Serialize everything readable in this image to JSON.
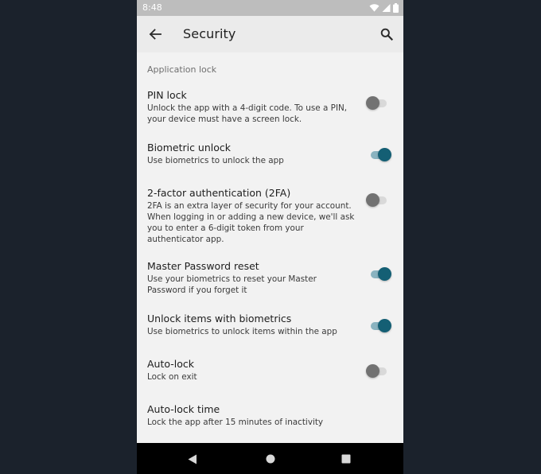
{
  "status_bar": {
    "time": "8:48",
    "icons": [
      "wifi-icon",
      "signal-icon",
      "battery-icon"
    ]
  },
  "app_bar": {
    "title": "Security",
    "back_icon": "arrow-back-icon",
    "search_icon": "search-icon"
  },
  "section": {
    "header": "Application lock"
  },
  "settings": [
    {
      "title": "PIN lock",
      "description": "Unlock the app with a 4-digit code. To use a PIN, your device must have a screen lock.",
      "enabled": false
    },
    {
      "title": "Biometric unlock",
      "description": "Use biometrics to unlock the app",
      "enabled": true
    },
    {
      "title": "2-factor authentication (2FA)",
      "description": "2FA is an extra layer of security for your account. When logging in or adding a new device, we'll ask you to enter a 6-digit token from your authenticator app.",
      "enabled": false
    },
    {
      "title": "Master Password reset",
      "description": "Use your biometrics to reset your Master Password if you forget it",
      "enabled": true
    },
    {
      "title": "Unlock items with biometrics",
      "description": "Use biometrics to unlock items within the app",
      "enabled": true
    },
    {
      "title": "Auto-lock",
      "description": "Lock on exit",
      "enabled": false
    },
    {
      "title": "Auto-lock time",
      "description": "Lock the app after 15 minutes of inactivity"
    }
  ],
  "colors": {
    "accent": "#145f74",
    "accent_track": "#8ab3c0",
    "switch_off_thumb": "#727272",
    "switch_off_track": "#d9d9d9",
    "background": "#f2f2f2",
    "app_bar": "#ebebeb",
    "status_bar": "#bdbdbd",
    "outer_background": "#1b222c"
  },
  "nav_bar": {
    "items": [
      "back-nav-icon",
      "home-nav-icon",
      "recents-nav-icon"
    ]
  }
}
